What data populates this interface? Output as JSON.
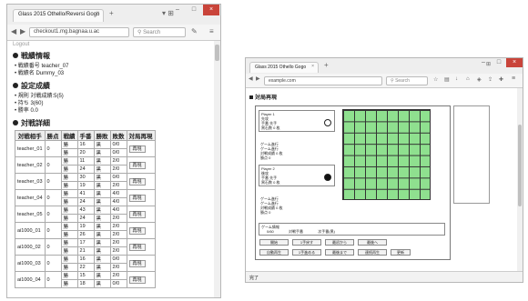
{
  "left_window": {
    "tab_title": "Glass 2015 Othello/Reversi Gogo",
    "url": "checkout1.mg.bagnaa.u.ac",
    "search_placeholder": "Search",
    "partial_heading": "Logout",
    "sections": {
      "match_info": {
        "title": "戦績情報",
        "lines": [
          "戦績番号 teacher_07",
          "戦績名 Dummy_03"
        ]
      },
      "settings": {
        "title": "設定成績",
        "lines": [
          "規則 対戦成績:5(5)",
          "持ち 3(60)",
          "勝率 0.0"
        ]
      },
      "results": {
        "title": "対戦詳細",
        "headers": [
          "対戦相手",
          "勝点",
          "戦績",
          "手番",
          "勝敗",
          "敗数",
          "対局再現"
        ],
        "rows": [
          {
            "opponent": "teacher_01",
            "pts": "0",
            "rec": [
              "勝",
              "勝"
            ],
            "turn": [
              "16",
              "20"
            ],
            "side": [
              "黒",
              "黒"
            ],
            "score": [
              "0/0",
              "0/0"
            ],
            "replay": "再現"
          },
          {
            "opponent": "teacher_02",
            "pts": "0",
            "rec": [
              "勝",
              "勝"
            ],
            "turn": [
              "11",
              "24"
            ],
            "side": [
              "黒",
              "黒"
            ],
            "score": [
              "2/0",
              "2/0"
            ],
            "replay": "再現"
          },
          {
            "opponent": "teacher_03",
            "pts": "0",
            "rec": [
              "勝",
              "勝"
            ],
            "turn": [
              "30",
              "19"
            ],
            "side": [
              "黒",
              "黒"
            ],
            "score": [
              "0/0",
              "2/0"
            ],
            "replay": "再現"
          },
          {
            "opponent": "teacher_04",
            "pts": "0",
            "rec": [
              "勝",
              "勝"
            ],
            "turn": [
              "41",
              "24"
            ],
            "side": [
              "黒",
              "黒"
            ],
            "score": [
              "4/0",
              "4/0"
            ],
            "replay": "再現"
          },
          {
            "opponent": "teacher_05",
            "pts": "0",
            "rec": [
              "勝",
              "勝"
            ],
            "turn": [
              "43",
              "24"
            ],
            "side": [
              "黒",
              "黒"
            ],
            "score": [
              "4/0",
              "2/0"
            ],
            "replay": "再現"
          },
          {
            "opponent": "ai1000_01",
            "pts": "0",
            "rec": [
              "勝",
              "勝"
            ],
            "turn": [
              "19",
              "26"
            ],
            "side": [
              "黒",
              "黒"
            ],
            "score": [
              "2/0",
              "2/0"
            ],
            "replay": "再現"
          },
          {
            "opponent": "ai1000_02",
            "pts": "0",
            "rec": [
              "勝",
              "勝"
            ],
            "turn": [
              "17",
              "21"
            ],
            "side": [
              "黒",
              "黒"
            ],
            "score": [
              "2/0",
              "2/0"
            ],
            "replay": "再現"
          },
          {
            "opponent": "ai1000_03",
            "pts": "0",
            "rec": [
              "勝",
              "勝"
            ],
            "turn": [
              "16",
              "22"
            ],
            "side": [
              "黒",
              "黒"
            ],
            "score": [
              "0/0",
              "2/0"
            ],
            "replay": "再現"
          },
          {
            "opponent": "ai1000_04",
            "pts": "0",
            "rec": [
              "勝",
              "勝"
            ],
            "turn": [
              "15",
              "18"
            ],
            "side": [
              "黒",
              "黒"
            ],
            "score": [
              "2/0",
              "0/0"
            ],
            "replay": "再現"
          }
        ]
      }
    }
  },
  "right_window": {
    "tab_title": "Glass 2015 Othello Gogo",
    "url": "example.com",
    "search_placeholder": "Search",
    "section_title": "対局再現",
    "player1": {
      "title": "Player 1",
      "name": "先攻",
      "type": "手番 先手",
      "stones": "黒石数  0 枚"
    },
    "player1_info": [
      "ゲーム進行",
      "ゲーム進行",
      "対戦成績  0 枚",
      "勝点  0"
    ],
    "player2": {
      "title": "Player 2",
      "name": "後攻",
      "type": "手番 先手",
      "stones": "黒石数  0 枚"
    },
    "player2_info": [
      "ゲーム進行",
      "ゲーム進行",
      "対戦成績  0 枚",
      "勝点  0"
    ],
    "game_info": {
      "label": "ゲーム情報",
      "items": [
        "0/60",
        "対戦手番",
        "次手番(黒)"
      ]
    },
    "buttons_row1": [
      "開始",
      "1手戻す",
      "最初から",
      "最後へ"
    ],
    "buttons_row2": [
      "自動再生",
      "1手進める",
      "最後まで",
      "連続再生",
      "更新"
    ],
    "status": "完了"
  }
}
